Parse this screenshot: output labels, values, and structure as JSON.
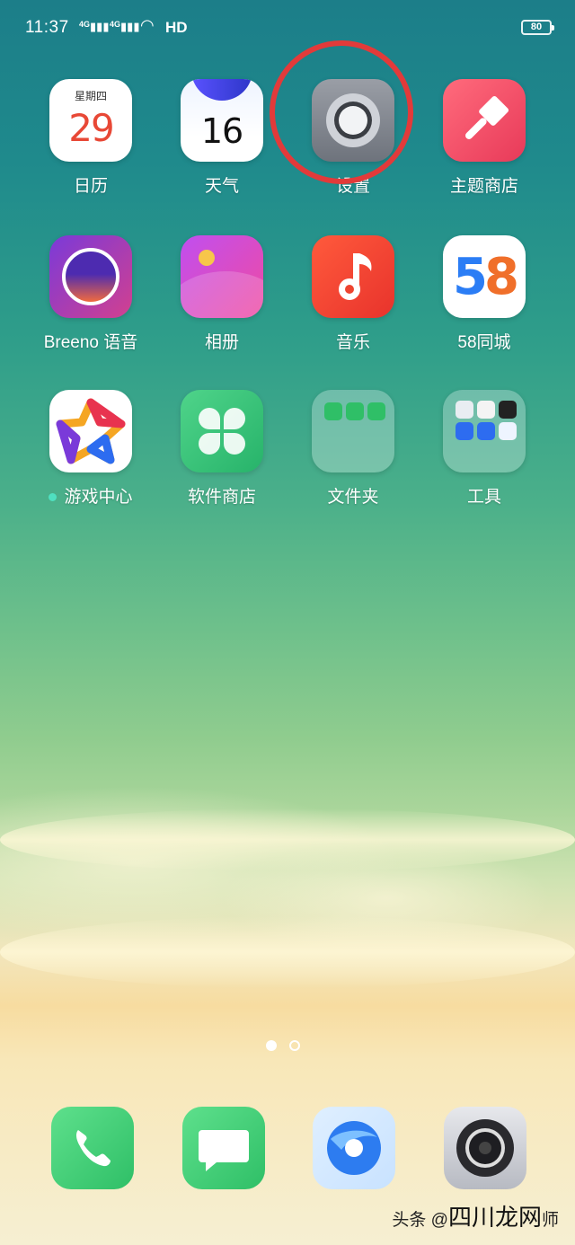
{
  "status_bar": {
    "time": "11:37",
    "signal1": "4G",
    "signal2": "4G",
    "hd": "HD",
    "battery": "80"
  },
  "apps": [
    {
      "label": "日历",
      "weekday": "星期四",
      "day": "29"
    },
    {
      "label": "天气",
      "number": "16"
    },
    {
      "label": "设置"
    },
    {
      "label": "主题商店"
    },
    {
      "label": "Breeno 语音"
    },
    {
      "label": "相册"
    },
    {
      "label": "音乐"
    },
    {
      "label": "58同城",
      "logo": "58"
    },
    {
      "label": "游戏中心"
    },
    {
      "label": "软件商店"
    },
    {
      "label": "文件夹"
    },
    {
      "label": "工具"
    }
  ],
  "pager": {
    "pages": 2,
    "current": 1
  },
  "dock": [
    "phone-icon",
    "message-icon",
    "browser-icon",
    "camera-icon"
  ],
  "watermark": {
    "prefix": "头条 @",
    "text": "四川龙网",
    "suffix": "师"
  },
  "annotation_color": "#e23a3a"
}
